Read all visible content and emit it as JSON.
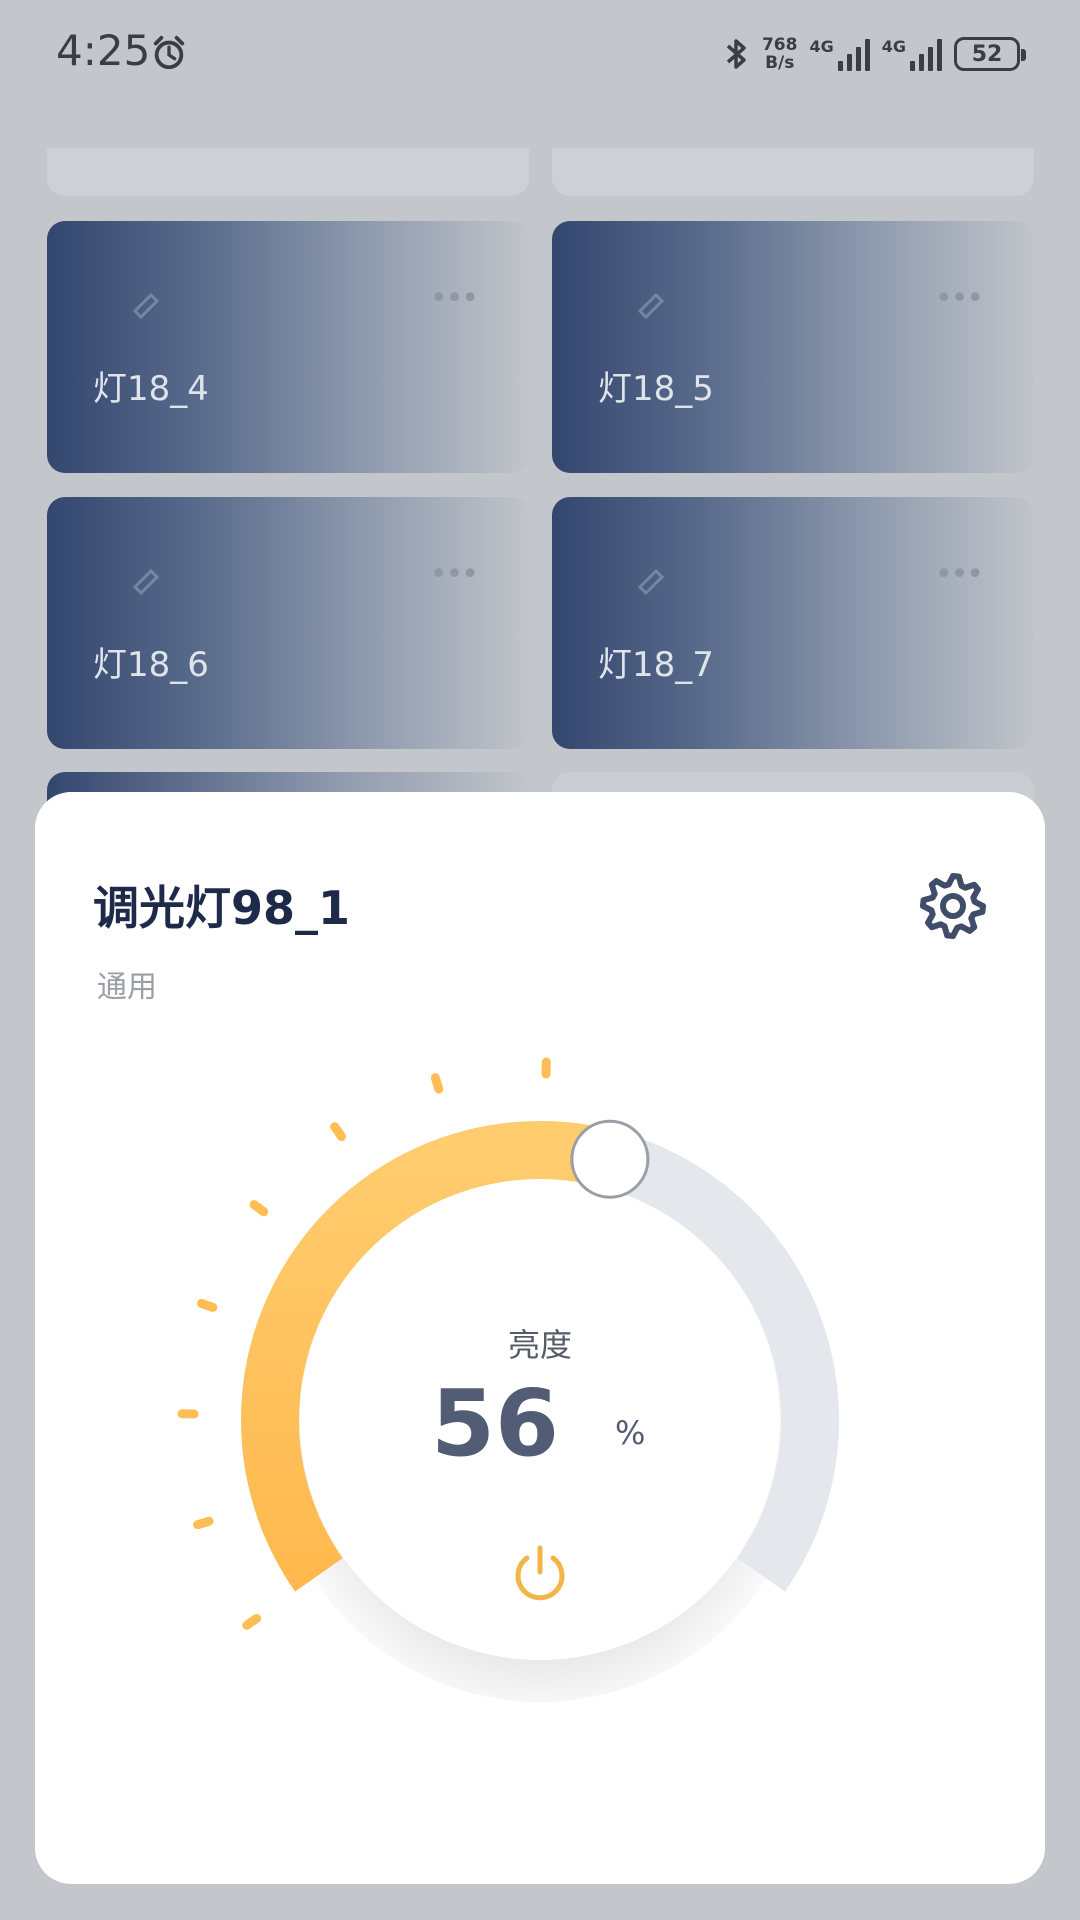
{
  "status_bar": {
    "time": "4:25",
    "net_speed_value": "768",
    "net_speed_unit": "B/s",
    "sim1": "4G",
    "sim2": "4G",
    "battery": "52"
  },
  "cards": [
    {
      "name": "灯18_4"
    },
    {
      "name": "灯18_5"
    },
    {
      "name": "灯18_6"
    },
    {
      "name": "灯18_7"
    }
  ],
  "sheet": {
    "title": "调光灯98_1",
    "subtitle": "通用",
    "dial_label": "亮度",
    "brightness": 56,
    "unit": "%"
  },
  "colors": {
    "accent": "#ffbe55",
    "track": "#e4e7ec",
    "card_dark": "#33466e"
  },
  "icons": [
    "alarm-icon",
    "bluetooth-icon",
    "signal-icon",
    "battery-icon",
    "more-icon",
    "light-icon",
    "gear-icon",
    "power-icon"
  ]
}
